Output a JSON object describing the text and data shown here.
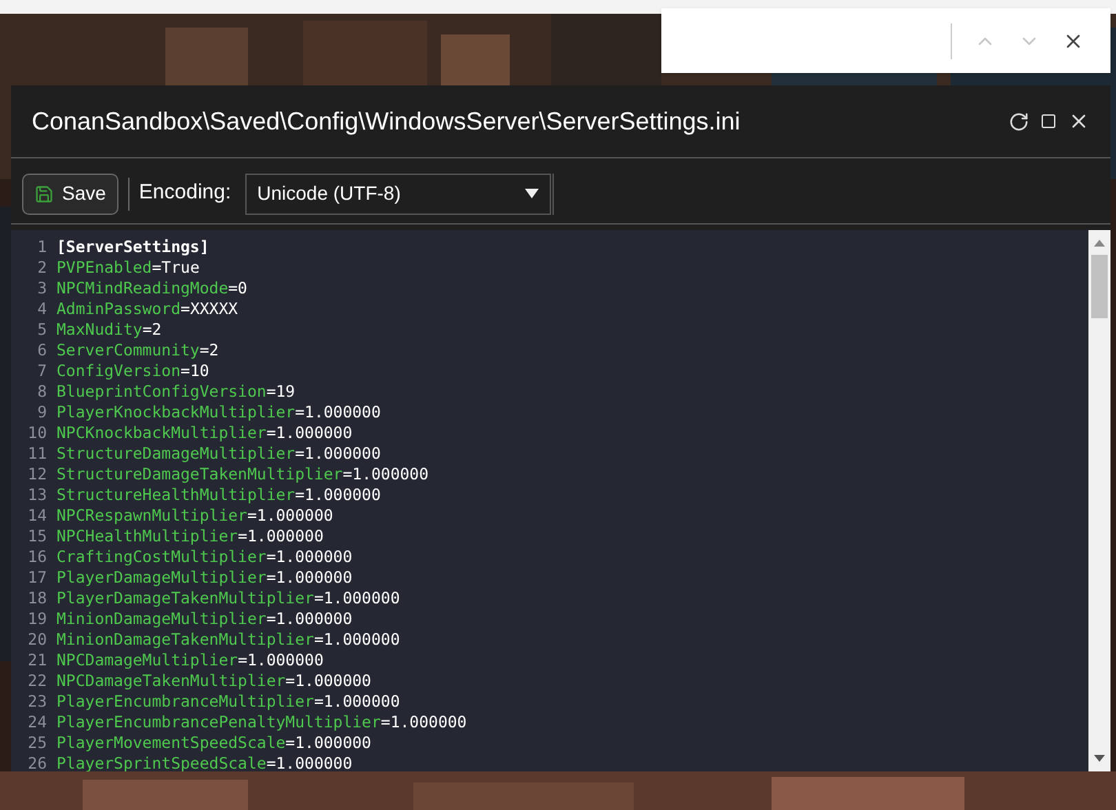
{
  "window": {
    "title": "ConanSandbox\\Saved\\Config\\WindowsServer\\ServerSettings.ini"
  },
  "toolbar": {
    "save_label": "Save",
    "encoding_label": "Encoding:",
    "encoding_value": "Unicode (UTF-8)"
  },
  "editor": {
    "lines": [
      {
        "number": "1",
        "kind": "section",
        "text": "[ServerSettings]"
      },
      {
        "number": "2",
        "kind": "pair",
        "key": "PVPEnabled",
        "value": "=True"
      },
      {
        "number": "3",
        "kind": "pair",
        "key": "NPCMindReadingMode",
        "value": "=0"
      },
      {
        "number": "4",
        "kind": "pair",
        "key": "AdminPassword",
        "value": "=XXXXX"
      },
      {
        "number": "5",
        "kind": "pair",
        "key": "MaxNudity",
        "value": "=2"
      },
      {
        "number": "6",
        "kind": "pair",
        "key": "ServerCommunity",
        "value": "=2"
      },
      {
        "number": "7",
        "kind": "pair",
        "key": "ConfigVersion",
        "value": "=10"
      },
      {
        "number": "8",
        "kind": "pair",
        "key": "BlueprintConfigVersion",
        "value": "=19"
      },
      {
        "number": "9",
        "kind": "pair",
        "key": "PlayerKnockbackMultiplier",
        "value": "=1.000000"
      },
      {
        "number": "10",
        "kind": "pair",
        "key": "NPCKnockbackMultiplier",
        "value": "=1.000000"
      },
      {
        "number": "11",
        "kind": "pair",
        "key": "StructureDamageMultiplier",
        "value": "=1.000000"
      },
      {
        "number": "12",
        "kind": "pair",
        "key": "StructureDamageTakenMultiplier",
        "value": "=1.000000"
      },
      {
        "number": "13",
        "kind": "pair",
        "key": "StructureHealthMultiplier",
        "value": "=1.000000"
      },
      {
        "number": "14",
        "kind": "pair",
        "key": "NPCRespawnMultiplier",
        "value": "=1.000000"
      },
      {
        "number": "15",
        "kind": "pair",
        "key": "NPCHealthMultiplier",
        "value": "=1.000000"
      },
      {
        "number": "16",
        "kind": "pair",
        "key": "CraftingCostMultiplier",
        "value": "=1.000000"
      },
      {
        "number": "17",
        "kind": "pair",
        "key": "PlayerDamageMultiplier",
        "value": "=1.000000"
      },
      {
        "number": "18",
        "kind": "pair",
        "key": "PlayerDamageTakenMultiplier",
        "value": "=1.000000"
      },
      {
        "number": "19",
        "kind": "pair",
        "key": "MinionDamageMultiplier",
        "value": "=1.000000"
      },
      {
        "number": "20",
        "kind": "pair",
        "key": "MinionDamageTakenMultiplier",
        "value": "=1.000000"
      },
      {
        "number": "21",
        "kind": "pair",
        "key": "NPCDamageMultiplier",
        "value": "=1.000000"
      },
      {
        "number": "22",
        "kind": "pair",
        "key": "NPCDamageTakenMultiplier",
        "value": "=1.000000"
      },
      {
        "number": "23",
        "kind": "pair",
        "key": "PlayerEncumbranceMultiplier",
        "value": "=1.000000"
      },
      {
        "number": "24",
        "kind": "pair",
        "key": "PlayerEncumbrancePenaltyMultiplier",
        "value": "=1.000000"
      },
      {
        "number": "25",
        "kind": "pair",
        "key": "PlayerMovementSpeedScale",
        "value": "=1.000000"
      },
      {
        "number": "26",
        "kind": "pair",
        "key": "PlayerSprintSpeedScale",
        "value": "=1.000000"
      }
    ]
  }
}
